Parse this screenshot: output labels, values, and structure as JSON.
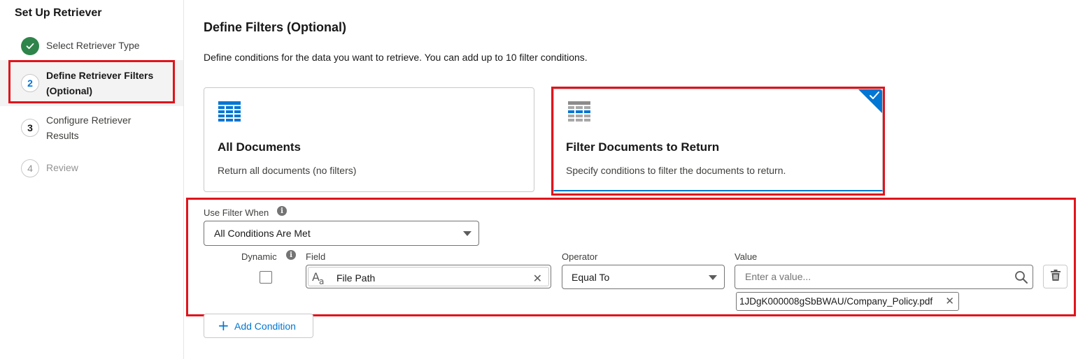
{
  "sidebar": {
    "title": "Set Up Retriever",
    "steps": [
      {
        "number": "",
        "label_line1": "Select Retriever Type",
        "label_line2": "",
        "status": "complete"
      },
      {
        "number": "2",
        "label_line1": "Define Retriever Filters",
        "label_line2": "(Optional)",
        "status": "current"
      },
      {
        "number": "3",
        "label_line1": "Configure Retriever",
        "label_line2": "Results",
        "status": "upcoming"
      },
      {
        "number": "4",
        "label_line1": "Review",
        "label_line2": "",
        "status": "disabled"
      }
    ]
  },
  "main": {
    "title": "Define Filters (Optional)",
    "description": "Define conditions for the data you want to retrieve. You can add up to 10 filter conditions.",
    "cards": [
      {
        "title": "All Documents",
        "description": "Return all documents (no filters)",
        "selected": false,
        "icon": "table-icon"
      },
      {
        "title": "Filter Documents to Return",
        "description": "Specify conditions to filter the documents to return.",
        "selected": true,
        "icon": "filtered-table-icon"
      }
    ],
    "filter": {
      "use_filter_when_label": "Use Filter When",
      "use_filter_when_value": "All Conditions Are Met",
      "dynamic_label": "Dynamic",
      "dynamic_checked": false,
      "field_label": "Field",
      "field_value": "File Path",
      "field_icon": "text-field-icon",
      "operator_label": "Operator",
      "operator_value": "Equal To",
      "value_label": "Value",
      "value_placeholder": "Enter a value...",
      "value_pill": "1JDgK000008gSbBWAU/Company_Policy.pdf",
      "add_condition_label": "Add Condition"
    }
  },
  "colors": {
    "brand": "#0176d3",
    "success": "#2e844a",
    "highlight_box": "#e0141c"
  }
}
